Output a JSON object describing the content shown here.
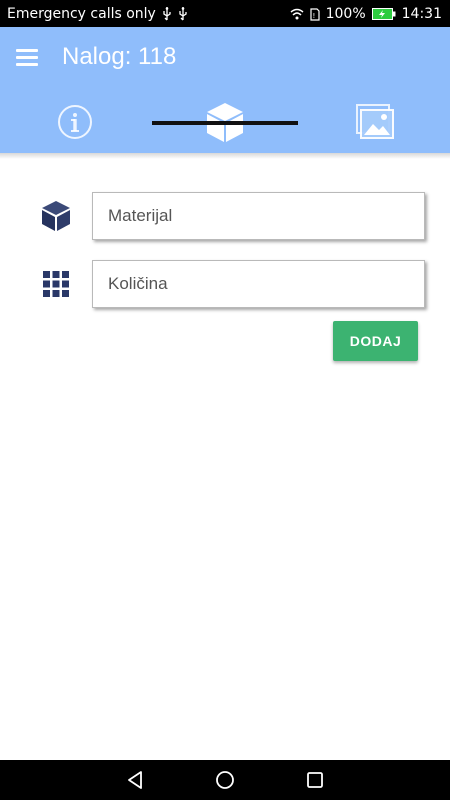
{
  "status_bar": {
    "carrier_text": "Emergency calls only",
    "battery_percent": "100%",
    "time": "14:31",
    "icons": [
      "usb-icon",
      "usb-icon",
      "wifi-icon",
      "sim-icon",
      "battery-charging-icon"
    ]
  },
  "header": {
    "title": "Nalog: 118",
    "menu_icon": "hamburger-menu-icon",
    "background_color": "#8fbdfb"
  },
  "tabs": [
    {
      "icon": "info-icon",
      "active": false
    },
    {
      "icon": "cube-icon",
      "active": true
    },
    {
      "icon": "gallery-icon",
      "active": false
    }
  ],
  "form": {
    "material": {
      "icon": "cube-icon",
      "placeholder": "Materijal",
      "value": ""
    },
    "quantity": {
      "icon": "grid-icon",
      "placeholder": "Količina",
      "value": ""
    },
    "add_button_label": "DODAJ",
    "add_button_color": "#3cb371"
  },
  "nav_bar": {
    "icons": [
      "back-icon",
      "home-icon",
      "recents-icon"
    ]
  }
}
